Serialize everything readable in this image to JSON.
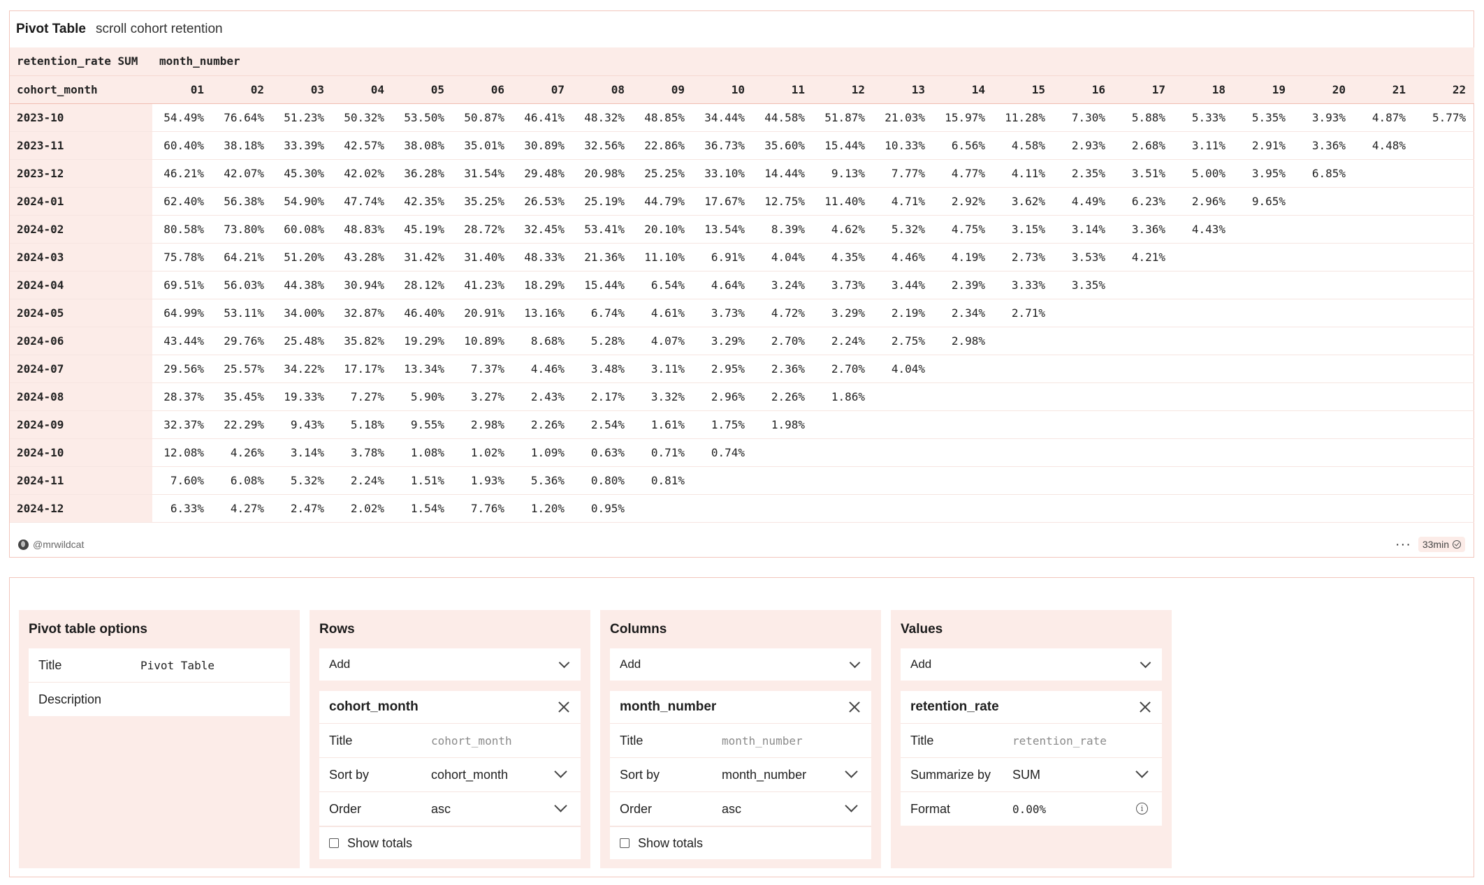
{
  "card": {
    "title": "Pivot Table",
    "description": "scroll cohort retention",
    "author": "@mrwildcat",
    "time": "33min"
  },
  "pivot": {
    "value_label": "retention_rate SUM",
    "column_field": "month_number",
    "row_field": "cohort_month",
    "columns": [
      "01",
      "02",
      "03",
      "04",
      "05",
      "06",
      "07",
      "08",
      "09",
      "10",
      "11",
      "12",
      "13",
      "14",
      "15",
      "16",
      "17",
      "18",
      "19",
      "20",
      "21",
      "22"
    ],
    "rows": [
      {
        "label": "2023-10",
        "values": [
          "54.49%",
          "76.64%",
          "51.23%",
          "50.32%",
          "53.50%",
          "50.87%",
          "46.41%",
          "48.32%",
          "48.85%",
          "34.44%",
          "44.58%",
          "51.87%",
          "21.03%",
          "15.97%",
          "11.28%",
          "7.30%",
          "5.88%",
          "5.33%",
          "5.35%",
          "3.93%",
          "4.87%",
          "5.77%"
        ]
      },
      {
        "label": "2023-11",
        "values": [
          "60.40%",
          "38.18%",
          "33.39%",
          "42.57%",
          "38.08%",
          "35.01%",
          "30.89%",
          "32.56%",
          "22.86%",
          "36.73%",
          "35.60%",
          "15.44%",
          "10.33%",
          "6.56%",
          "4.58%",
          "2.93%",
          "2.68%",
          "3.11%",
          "2.91%",
          "3.36%",
          "4.48%",
          ""
        ]
      },
      {
        "label": "2023-12",
        "values": [
          "46.21%",
          "42.07%",
          "45.30%",
          "42.02%",
          "36.28%",
          "31.54%",
          "29.48%",
          "20.98%",
          "25.25%",
          "33.10%",
          "14.44%",
          "9.13%",
          "7.77%",
          "4.77%",
          "4.11%",
          "2.35%",
          "3.51%",
          "5.00%",
          "3.95%",
          "6.85%",
          "",
          ""
        ]
      },
      {
        "label": "2024-01",
        "values": [
          "62.40%",
          "56.38%",
          "54.90%",
          "47.74%",
          "42.35%",
          "35.25%",
          "26.53%",
          "25.19%",
          "44.79%",
          "17.67%",
          "12.75%",
          "11.40%",
          "4.71%",
          "2.92%",
          "3.62%",
          "4.49%",
          "6.23%",
          "2.96%",
          "9.65%",
          "",
          "",
          ""
        ]
      },
      {
        "label": "2024-02",
        "values": [
          "80.58%",
          "73.80%",
          "60.08%",
          "48.83%",
          "45.19%",
          "28.72%",
          "32.45%",
          "53.41%",
          "20.10%",
          "13.54%",
          "8.39%",
          "4.62%",
          "5.32%",
          "4.75%",
          "3.15%",
          "3.14%",
          "3.36%",
          "4.43%",
          "",
          "",
          "",
          ""
        ]
      },
      {
        "label": "2024-03",
        "values": [
          "75.78%",
          "64.21%",
          "51.20%",
          "43.28%",
          "31.42%",
          "31.40%",
          "48.33%",
          "21.36%",
          "11.10%",
          "6.91%",
          "4.04%",
          "4.35%",
          "4.46%",
          "4.19%",
          "2.73%",
          "3.53%",
          "4.21%",
          "",
          "",
          "",
          "",
          ""
        ]
      },
      {
        "label": "2024-04",
        "values": [
          "69.51%",
          "56.03%",
          "44.38%",
          "30.94%",
          "28.12%",
          "41.23%",
          "18.29%",
          "15.44%",
          "6.54%",
          "4.64%",
          "3.24%",
          "3.73%",
          "3.44%",
          "2.39%",
          "3.33%",
          "3.35%",
          "",
          "",
          "",
          "",
          "",
          ""
        ]
      },
      {
        "label": "2024-05",
        "values": [
          "64.99%",
          "53.11%",
          "34.00%",
          "32.87%",
          "46.40%",
          "20.91%",
          "13.16%",
          "6.74%",
          "4.61%",
          "3.73%",
          "4.72%",
          "3.29%",
          "2.19%",
          "2.34%",
          "2.71%",
          "",
          "",
          "",
          "",
          "",
          "",
          ""
        ]
      },
      {
        "label": "2024-06",
        "values": [
          "43.44%",
          "29.76%",
          "25.48%",
          "35.82%",
          "19.29%",
          "10.89%",
          "8.68%",
          "5.28%",
          "4.07%",
          "3.29%",
          "2.70%",
          "2.24%",
          "2.75%",
          "2.98%",
          "",
          "",
          "",
          "",
          "",
          "",
          "",
          ""
        ]
      },
      {
        "label": "2024-07",
        "values": [
          "29.56%",
          "25.57%",
          "34.22%",
          "17.17%",
          "13.34%",
          "7.37%",
          "4.46%",
          "3.48%",
          "3.11%",
          "2.95%",
          "2.36%",
          "2.70%",
          "4.04%",
          "",
          "",
          "",
          "",
          "",
          "",
          "",
          "",
          ""
        ]
      },
      {
        "label": "2024-08",
        "values": [
          "28.37%",
          "35.45%",
          "19.33%",
          "7.27%",
          "5.90%",
          "3.27%",
          "2.43%",
          "2.17%",
          "3.32%",
          "2.96%",
          "2.26%",
          "1.86%",
          "",
          "",
          "",
          "",
          "",
          "",
          "",
          "",
          "",
          ""
        ]
      },
      {
        "label": "2024-09",
        "values": [
          "32.37%",
          "22.29%",
          "9.43%",
          "5.18%",
          "9.55%",
          "2.98%",
          "2.26%",
          "2.54%",
          "1.61%",
          "1.75%",
          "1.98%",
          "",
          "",
          "",
          "",
          "",
          "",
          "",
          "",
          "",
          "",
          ""
        ]
      },
      {
        "label": "2024-10",
        "values": [
          "12.08%",
          "4.26%",
          "3.14%",
          "3.78%",
          "1.08%",
          "1.02%",
          "1.09%",
          "0.63%",
          "0.71%",
          "0.74%",
          "",
          "",
          "",
          "",
          "",
          "",
          "",
          "",
          "",
          "",
          "",
          ""
        ]
      },
      {
        "label": "2024-11",
        "values": [
          "7.60%",
          "6.08%",
          "5.32%",
          "2.24%",
          "1.51%",
          "1.93%",
          "5.36%",
          "0.80%",
          "0.81%",
          "",
          "",
          "",
          "",
          "",
          "",
          "",
          "",
          "",
          "",
          "",
          "",
          ""
        ]
      },
      {
        "label": "2024-12",
        "values": [
          "6.33%",
          "4.27%",
          "2.47%",
          "2.02%",
          "1.54%",
          "7.76%",
          "1.20%",
          "0.95%",
          "",
          "",
          "",
          "",
          "",
          "",
          "",
          "",
          "",
          "",
          "",
          "",
          "",
          ""
        ]
      }
    ]
  },
  "options": {
    "title": "Pivot table options",
    "title_label": "Title",
    "title_value": "Pivot Table",
    "description_label": "Description"
  },
  "rows_panel": {
    "title": "Rows",
    "add_label": "Add",
    "field": "cohort_month",
    "title_label": "Title",
    "title_placeholder": "cohort_month",
    "sort_label": "Sort by",
    "sort_value": "cohort_month",
    "order_label": "Order",
    "order_value": "asc",
    "totals_label": "Show totals"
  },
  "columns_panel": {
    "title": "Columns",
    "add_label": "Add",
    "field": "month_number",
    "title_label": "Title",
    "title_placeholder": "month_number",
    "sort_label": "Sort by",
    "sort_value": "month_number",
    "order_label": "Order",
    "order_value": "asc",
    "totals_label": "Show totals"
  },
  "values_panel": {
    "title": "Values",
    "add_label": "Add",
    "field": "retention_rate",
    "title_label": "Title",
    "title_placeholder": "retention_rate",
    "summarize_label": "Summarize by",
    "summarize_value": "SUM",
    "format_label": "Format",
    "format_value": "0.00%"
  },
  "colors": {
    "accent_bg": "#fcece8",
    "border": "#f2c6bc"
  }
}
